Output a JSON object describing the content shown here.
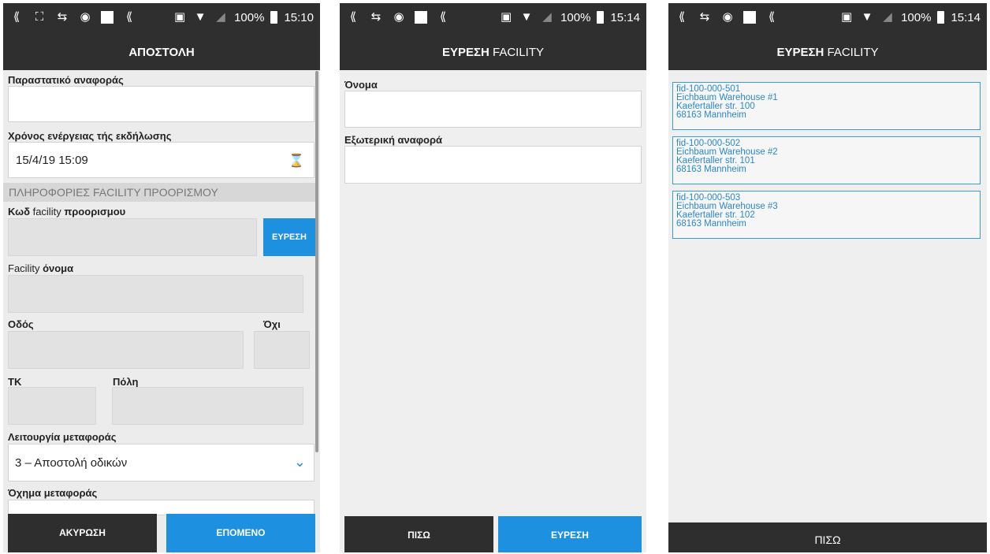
{
  "status_bar": {
    "screen1": {
      "battery": "100%",
      "time": "15:10"
    },
    "screen2": {
      "battery": "100%",
      "time": "15:14"
    },
    "screen3": {
      "battery": "100%",
      "time": "15:14"
    }
  },
  "screen1": {
    "title": "ΑΠΟΣΤΟΛΗ",
    "reference_document_label": "Παραστατικό αναφοράς",
    "reference_document_value": "",
    "event_time_label": "Χρόνος ενέργειας τής εκδήλωσης",
    "event_time_value": "15/4/19 15:09",
    "section_header": "ΠΛΗΡΟΦΟΡΙΕΣ FACILITY ΠΡΟΟΡΙΣΜΟΥ",
    "dest_code_label_bold": "Κωδ",
    "dest_code_label_normal": " facility ",
    "dest_code_label_bold2": "προορισμου",
    "find_button": "ΕΥΡΕΣΗ",
    "facility_name_label_normal": "Facility ",
    "facility_name_label_bold": "όνομα",
    "street_label": "Οδός",
    "number_label": "Όχι",
    "zip_label": "ΤΚ",
    "city_label": "Πόλη",
    "transport_mode_label": "Λειτουργία μεταφοράς",
    "transport_mode_value": "3 – Αποστολή οδικών",
    "vehicle_label": "Όχημα μεταφοράς",
    "cancel_button": "ΑΚΥΡΩΣΗ",
    "next_button": "ΕΠΟΜΕΝΟ"
  },
  "screen2": {
    "title_bold": "ΕΥΡΕΣΗ",
    "title_normal": " FACILITY",
    "name_label": "Όνομα",
    "name_value": "",
    "external_ref_label": "Εξωτερική αναφορά",
    "external_ref_value": "",
    "back_button": "ΠΙΣΩ",
    "find_button": "ΕΥΡΕΣΗ"
  },
  "screen3": {
    "title_bold": "ΕΥΡΕΣΗ",
    "title_normal": " FACILITY",
    "results": [
      {
        "id": "fid-100-000-501",
        "name": "Eichbaum Warehouse #1",
        "street": "Kaefertaller str. 100",
        "city": "68163 Mannheim"
      },
      {
        "id": "fid-100-000-502",
        "name": "Eichbaum Warehouse #2",
        "street": "Kaefertaller str. 101",
        "city": "68163 Mannheim"
      },
      {
        "id": "fid-100-000-503",
        "name": "Eichbaum Warehouse #3",
        "street": "Kaefertaller str. 102",
        "city": "68163 Mannheim"
      }
    ],
    "back_button": "ΠΙΣΩ"
  },
  "colors": {
    "appbar": "#2f2f2f",
    "accent": "#1e90e0",
    "result_text": "#2a88c8"
  }
}
